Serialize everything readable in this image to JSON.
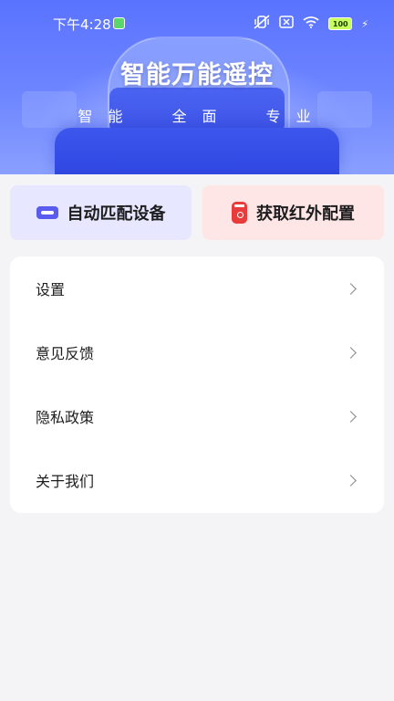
{
  "status_bar": {
    "time": "下午4:28",
    "battery": "100"
  },
  "hero": {
    "title": "智能万能遥控",
    "tags": [
      "智 能",
      "全 面",
      "专 业"
    ]
  },
  "actions": {
    "auto_match": {
      "label": "自动匹配设备",
      "icon": "device-icon",
      "bg": "#e7e8ff"
    },
    "ir_config": {
      "label": "获取红外配置",
      "icon": "remote-icon",
      "bg": "#ffe6e6"
    }
  },
  "menu": {
    "items": [
      {
        "label": "设置"
      },
      {
        "label": "意见反馈"
      },
      {
        "label": "隐私政策"
      },
      {
        "label": "关于我们"
      }
    ]
  },
  "colors": {
    "accent": "#5a73ff",
    "page_bg": "#f4f4f6"
  }
}
